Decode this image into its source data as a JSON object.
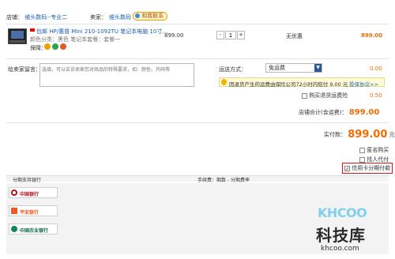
{
  "store": {
    "label": "店铺：",
    "name": "维头数码--专业二",
    "seller_label": "卖家：",
    "seller_name": "维头数码",
    "contact_label": "和我联系"
  },
  "item": {
    "title": "包邮 HP/惠普 Mini 210-1092TU 笔记本电脑 10寸…",
    "attrs": "颜色分类：黑色  笔记本套餐：套餐一",
    "guarantee_label": "保障：",
    "unit_price": "899.00",
    "quantity": "1",
    "discount": "无优惠",
    "subtotal": "899.00"
  },
  "message": {
    "label": "给卖家留言：",
    "placeholder": "选填，可以告诉卖家您对商品的特殊要求，如：颜色、尺码等"
  },
  "shipping": {
    "label": "运送方式：",
    "selected": "免运费",
    "fee": "0.00",
    "notice": "因退货产生的运费由保险公司72小时内赔付 9.00 元",
    "notice_link": "投保协议>>",
    "insurance_label": "购买退货运费险",
    "insurance_fee": "0.50"
  },
  "store_total": {
    "label": "店铺合计(含运费)：",
    "value": "899.00"
  },
  "payment": {
    "label": "实付款：",
    "amount": "899.00",
    "unit": "元",
    "anon_label": "匿名购买",
    "proxy_label": "找人代付",
    "credit_label": "信用卡分期付款"
  },
  "installment": {
    "col_bank": "分期支持银行",
    "col_fee": "手续费：期数 - 分期费率",
    "banks": [
      "中国银行",
      "平安银行",
      "中国农业银行"
    ]
  },
  "watermark": {
    "logo": "KHCOO",
    "cn": "科技库",
    "url": "khcoo.com"
  },
  "colors": {
    "accent": "#f26d00",
    "link": "#1b5fb4",
    "highlight_box": "#d4161c"
  }
}
